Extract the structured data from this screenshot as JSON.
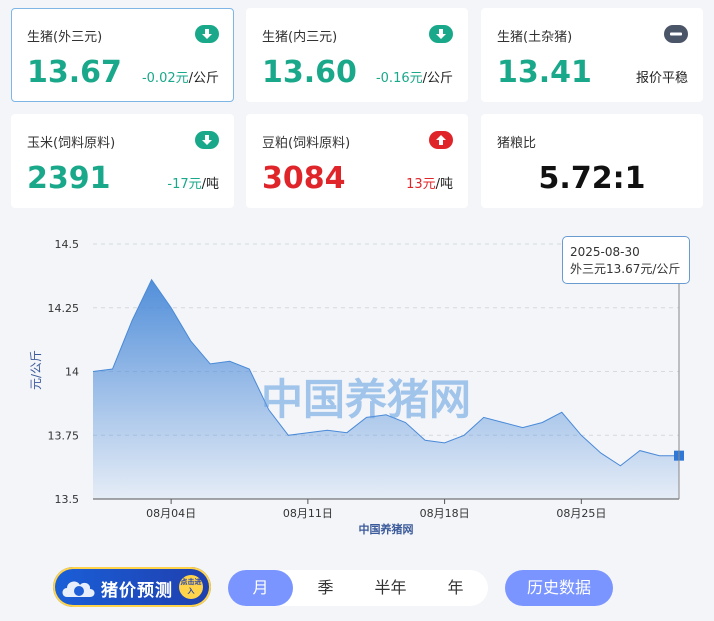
{
  "colors": {
    "down": "#1aa88b",
    "up": "#e0252a",
    "flat": "#4a5568",
    "line": "#4a8ad8",
    "accent": "#7a95ff"
  },
  "cards": [
    {
      "name": "生猪(外三元)",
      "price": "13.67",
      "change": "-0.02元",
      "unit": "/公斤",
      "trend": "down",
      "icon": "arrow-down-icon"
    },
    {
      "name": "生猪(内三元)",
      "price": "13.60",
      "change": "-0.16元",
      "unit": "/公斤",
      "trend": "down",
      "icon": "arrow-down-icon"
    },
    {
      "name": "生猪(土杂猪)",
      "price": "13.41",
      "change": "报价平稳",
      "unit": "",
      "trend": "flat",
      "icon": "minus-icon"
    },
    {
      "name": "玉米(饲料原料)",
      "price": "2391",
      "change": "-17元",
      "unit": "/吨",
      "trend": "down",
      "icon": "arrow-down-icon"
    },
    {
      "name": "豆粕(饲料原料)",
      "price": "3084",
      "change": "13元",
      "unit": "/吨",
      "trend": "up",
      "icon": "arrow-up-icon"
    },
    {
      "name": "猪粮比",
      "price": "5.72:1"
    }
  ],
  "chart_data": {
    "type": "area",
    "xlabel": "中国养猪网",
    "ylabel": "元/公斤",
    "ylim": [
      13.5,
      14.5
    ],
    "yticks": [
      "13.5",
      "13.75",
      "14",
      "14.25",
      "14.5"
    ],
    "x": [
      "2025-07-31",
      "2025-08-01",
      "2025-08-02",
      "2025-08-03",
      "2025-08-04",
      "2025-08-05",
      "2025-08-06",
      "2025-08-07",
      "2025-08-08",
      "2025-08-09",
      "2025-08-10",
      "2025-08-11",
      "2025-08-12",
      "2025-08-13",
      "2025-08-14",
      "2025-08-15",
      "2025-08-16",
      "2025-08-17",
      "2025-08-18",
      "2025-08-19",
      "2025-08-20",
      "2025-08-21",
      "2025-08-22",
      "2025-08-23",
      "2025-08-24",
      "2025-08-25",
      "2025-08-26",
      "2025-08-27",
      "2025-08-28",
      "2025-08-29",
      "2025-08-30"
    ],
    "xticks": [
      {
        "label": "08月04日",
        "index": 4
      },
      {
        "label": "08月11日",
        "index": 11
      },
      {
        "label": "08月18日",
        "index": 18
      },
      {
        "label": "08月25日",
        "index": 25
      }
    ],
    "series": [
      {
        "name": "外三元",
        "values": [
          14.0,
          14.01,
          14.2,
          14.36,
          14.25,
          14.12,
          14.03,
          14.04,
          14.01,
          13.85,
          13.75,
          13.76,
          13.77,
          13.76,
          13.82,
          13.83,
          13.8,
          13.73,
          13.72,
          13.75,
          13.82,
          13.8,
          13.78,
          13.8,
          13.84,
          13.75,
          13.68,
          13.63,
          13.69,
          13.67,
          13.67
        ]
      }
    ],
    "grid": true,
    "watermark": "中国养猪网"
  },
  "tooltip": {
    "date": "2025-08-30",
    "text": "外三元13.67元/公斤"
  },
  "banner": {
    "text": "猪价预测",
    "click": "点击进入"
  },
  "periods": [
    "月",
    "季",
    "半年",
    "年"
  ],
  "history": "历史数据"
}
